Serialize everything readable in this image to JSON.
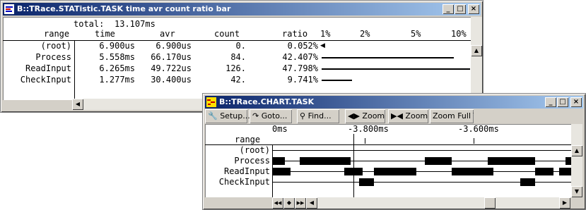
{
  "stat_window": {
    "title": "B::TRace.STATistic.TASK time avr count ratio bar",
    "total_label": "total:",
    "total_value": "13.107ms",
    "headers": [
      "range",
      "time",
      "avr",
      "count",
      "ratio",
      "1%",
      "2%",
      "5%",
      "10%"
    ],
    "rows": [
      {
        "range": "(root)",
        "time": "6.900us",
        "avr": "6.900us",
        "count": "0.",
        "ratio": "0.052%",
        "bar": 0.052
      },
      {
        "range": "Process",
        "time": "5.558ms",
        "avr": "66.170us",
        "count": "84.",
        "ratio": "42.407%",
        "bar": 42.407
      },
      {
        "range": "ReadInput",
        "time": "6.265ms",
        "avr": "49.722us",
        "count": "126.",
        "ratio": "47.798%",
        "bar": 47.798
      },
      {
        "range": "CheckInput",
        "time": "1.277ms",
        "avr": "30.400us",
        "count": "42.",
        "ratio": "9.741%",
        "bar": 9.741
      }
    ],
    "window_buttons": [
      "_",
      "□",
      "×"
    ]
  },
  "chart_window": {
    "title": "B::TRace.CHART.TASK",
    "toolbar": {
      "setup": "Setup...",
      "goto": "Goto...",
      "find": "Find...",
      "zoom_in": "Zoom",
      "zoom_out": "Zoom",
      "zoom_full": "Zoom Full T"
    },
    "time_labels": [
      "0ms",
      "-3.800ms",
      "-3.600ms"
    ],
    "range_header": "range",
    "tasks": [
      "(root)",
      "Process",
      "ReadInput",
      "CheckInput"
    ],
    "task_segments": [
      [],
      [
        [
          0.0,
          0.04
        ],
        [
          0.09,
          0.26
        ],
        [
          0.51,
          0.6
        ],
        [
          0.72,
          0.88
        ],
        [
          0.98,
          1.0
        ]
      ],
      [
        [
          0.0,
          0.06
        ],
        [
          0.24,
          0.3
        ],
        [
          0.34,
          0.48
        ],
        [
          0.6,
          0.74
        ],
        [
          0.88,
          0.94
        ],
        [
          0.96,
          1.0
        ]
      ],
      [
        [
          0.29,
          0.34
        ],
        [
          0.83,
          0.88
        ]
      ]
    ],
    "cursor_fraction": 0.27,
    "nav_buttons": [
      "◀◀",
      "◆",
      "▶▶",
      "◀"
    ],
    "window_buttons": [
      "_",
      "□",
      "×"
    ]
  }
}
